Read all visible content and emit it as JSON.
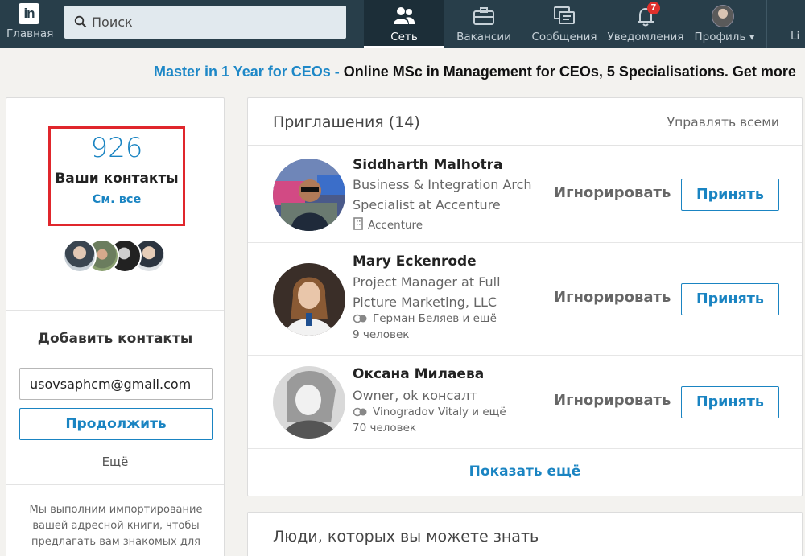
{
  "nav": {
    "logo_text": "in",
    "home_label": "Главная",
    "search_placeholder": "Поиск",
    "items": [
      {
        "label": "Сеть",
        "icon": "people-icon",
        "active": true
      },
      {
        "label": "Вакансии",
        "icon": "briefcase-icon"
      },
      {
        "label": "Сообщения",
        "icon": "messages-icon"
      },
      {
        "label": "Уведомления",
        "icon": "bell-icon",
        "badge": "7"
      },
      {
        "label": "Профиль",
        "icon": "avatar",
        "caret": "▾"
      }
    ],
    "cut_label": "Li"
  },
  "ad": {
    "link": "Master in 1 Year for CEOs -",
    "text": "Online MSc in Management for CEOs, 5 Specialisations. Get more"
  },
  "sidebar": {
    "count": "926",
    "count_label": "Ваши контакты",
    "see_all": "См. все",
    "add_title": "Добавить контакты",
    "email_value": "usovsaphcm@gmail.com",
    "continue_label": "Продолжить",
    "more_label": "Ещё",
    "fine_print": "Мы выполним импортирование вашей адресной книги, чтобы предлагать вам знакомых для"
  },
  "invitations": {
    "title": "Приглашения (14)",
    "manage_all": "Управлять всеми",
    "ignore_label": "Игнорировать",
    "accept_label": "Принять",
    "items": [
      {
        "name": "Siddharth Malhotra",
        "occupation": "Business & Integration Arch Specialist at Accenture",
        "meta": "Accenture",
        "meta_icon": "building-icon",
        "meta2": ""
      },
      {
        "name": "Mary Eckenrode",
        "occupation": "Project Manager at Full Picture Marketing, LLC",
        "meta": "Герман Беляев и ещё",
        "meta_icon": "shared-connections-icon",
        "meta2": "9 человек"
      },
      {
        "name": "Оксана Милаева",
        "occupation": "Owner, ok консалт",
        "meta": "Vinogradov Vitaly и ещё",
        "meta_icon": "shared-connections-icon",
        "meta2": "70 человек"
      }
    ],
    "show_more": "Показать ещё"
  },
  "people": {
    "title": "Люди, которых вы можете знать"
  },
  "colors": {
    "nav_bg": "#283e4a",
    "accent": "#1a84c2",
    "highlight_border": "#e0262c",
    "badge": "#e0302c"
  }
}
